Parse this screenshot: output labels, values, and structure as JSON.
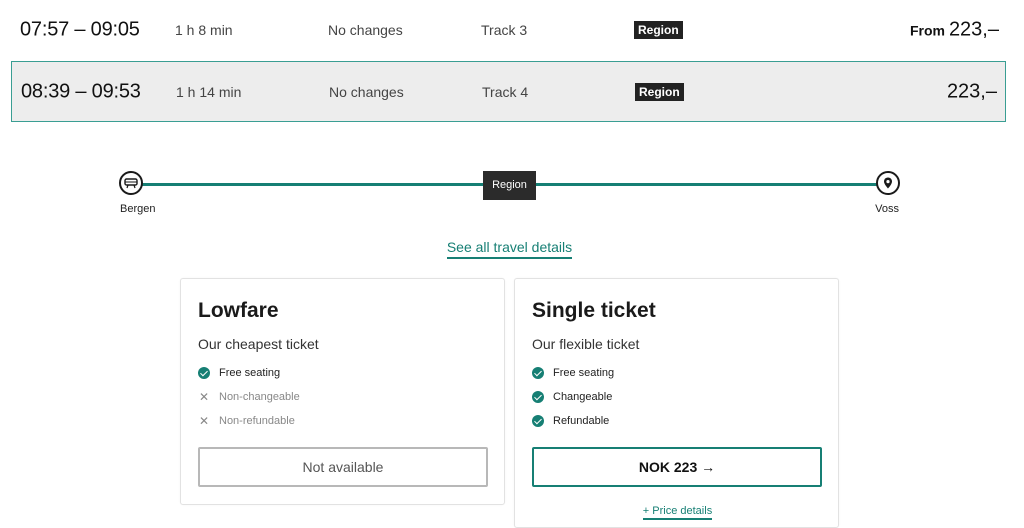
{
  "departures": [
    {
      "time": "07:57 – 09:05",
      "duration": "1 h 8 min",
      "changes": "No changes",
      "track": "Track 3",
      "badge": "Region",
      "price_prefix": "From",
      "price": "223,–"
    },
    {
      "time": "08:39 – 09:53",
      "duration": "1 h 14 min",
      "changes": "No changes",
      "track": "Track 4",
      "badge": "Region",
      "price_prefix": "",
      "price": "223,–"
    }
  ],
  "route": {
    "from": "Bergen",
    "to": "Voss",
    "line_label": "Region",
    "start_icon": "train-icon",
    "end_icon": "location-pin-icon"
  },
  "details_link": "See all travel details",
  "tickets": [
    {
      "title": "Lowfare",
      "subtitle": "Our cheapest ticket",
      "features": [
        {
          "label": "Free seating",
          "available": true
        },
        {
          "label": "Non-changeable",
          "available": false
        },
        {
          "label": "Non-refundable",
          "available": false
        }
      ],
      "button": "Not available"
    },
    {
      "title": "Single ticket",
      "subtitle": "Our flexible ticket",
      "features": [
        {
          "label": "Free seating",
          "available": true
        },
        {
          "label": "Changeable",
          "available": true
        },
        {
          "label": "Refundable",
          "available": true
        }
      ],
      "button": "NOK 223 →",
      "price_details": "+ Price details"
    }
  ],
  "colors": {
    "accent": "#167f74",
    "selected_row_bg": "#ededed",
    "badge_bg": "#222222"
  }
}
